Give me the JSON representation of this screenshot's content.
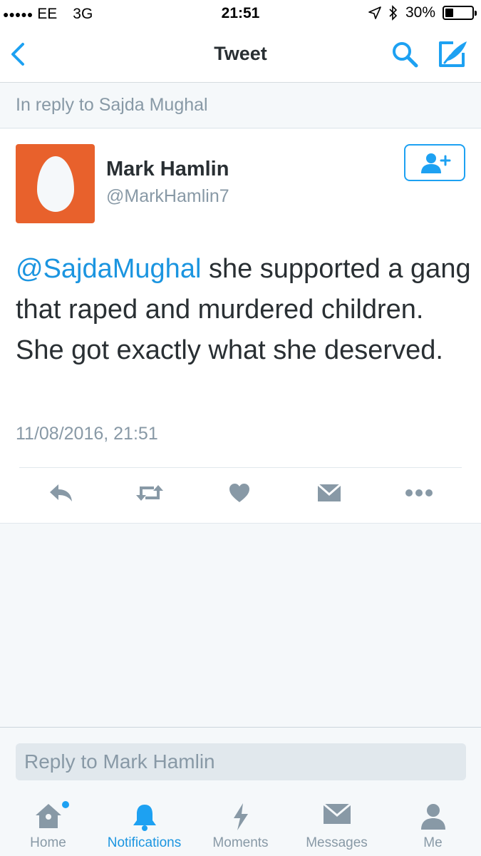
{
  "status_bar": {
    "signal": "●●●●●",
    "carrier": "EE",
    "network": "3G",
    "time": "21:51",
    "battery_percent": "30%",
    "battery_level": 0.3
  },
  "nav": {
    "title": "Tweet"
  },
  "reply_context": "In reply to Sajda Mughal",
  "tweet": {
    "author_name": "Mark Hamlin",
    "author_handle": "@MarkHamlin7",
    "mention": "@SajdaMughal",
    "text": " she supported a gang that raped and murdered children. She got exactly what she deserved.",
    "timestamp": "11/08/2016, 21:51"
  },
  "reply_box": {
    "placeholder": "Reply to Mark Hamlin"
  },
  "tabs": [
    {
      "label": "Home",
      "icon": "home-icon"
    },
    {
      "label": "Notifications",
      "icon": "bell-icon"
    },
    {
      "label": "Moments",
      "icon": "lightning-icon"
    },
    {
      "label": "Messages",
      "icon": "envelope-icon"
    },
    {
      "label": "Me",
      "icon": "person-icon"
    }
  ],
  "colors": {
    "accent": "#1da1f2",
    "link": "#1b95e0",
    "muted": "#8899a6",
    "avatar_bg": "#e8612c"
  }
}
